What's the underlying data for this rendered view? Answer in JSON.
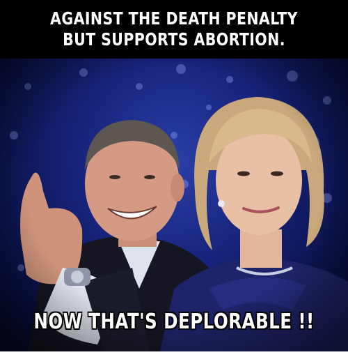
{
  "meme": {
    "top_text": "AGAINST THE DEATH PENALTY BUT SUPPORTS ABORTION.",
    "bottom_text": "NOW THAT'S DEPLORABLE !!"
  },
  "colors": {
    "caption": "#ffffff",
    "banner": "#000000",
    "backdrop": "#17237a"
  }
}
